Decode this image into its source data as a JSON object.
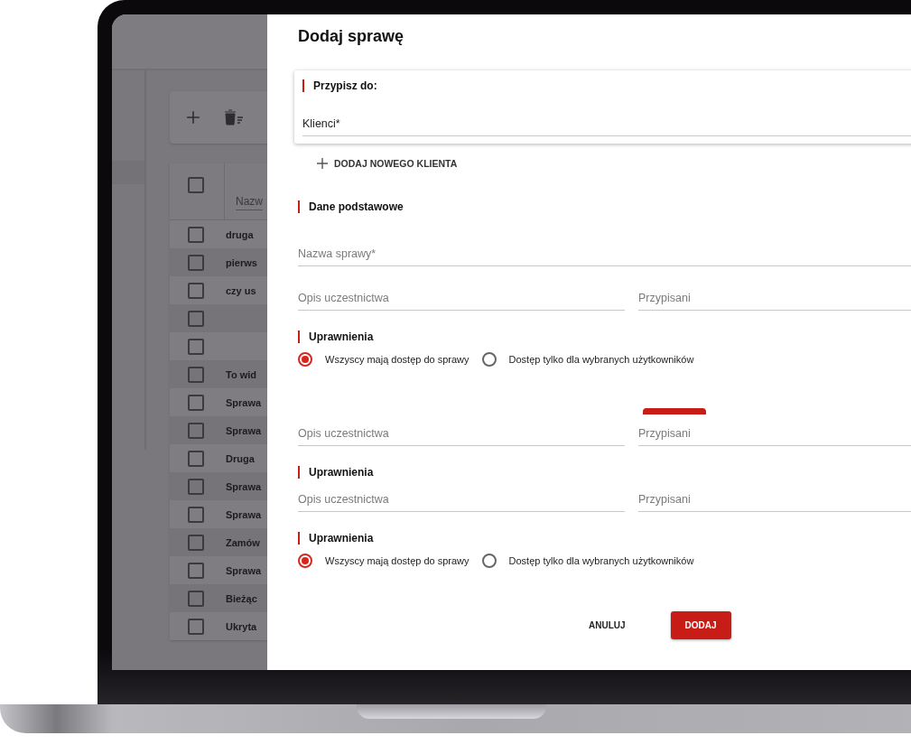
{
  "background_app": {
    "table": {
      "column_1": "Nazw",
      "header_checkbox": {
        "checked": false
      },
      "rows": [
        {
          "name": "druga",
          "checked": false
        },
        {
          "name": "pierws",
          "checked": false
        },
        {
          "name": "czy us",
          "checked": false
        },
        {
          "checked": false
        },
        {
          "checked": false
        },
        {
          "name": "To wid",
          "checked": false
        },
        {
          "name": "Sprawa",
          "checked": false
        },
        {
          "name": "Sprawa",
          "checked": false
        },
        {
          "name": "Druga",
          "checked": false
        },
        {
          "name": "Sprawa",
          "checked": false
        },
        {
          "name": "Sprawa",
          "checked": false
        },
        {
          "name": "Zamów",
          "checked": false
        },
        {
          "name": "Sprawa",
          "checked": false
        },
        {
          "name": "Bieżąc",
          "checked": false
        },
        {
          "name": "Ukryta",
          "checked": false
        }
      ]
    }
  },
  "dialog": {
    "title": "Dodaj sprawę",
    "blocks": [
      {
        "kind": "card",
        "heading": "Przypisz do:",
        "field": {
          "placeholder": "Klienci*"
        }
      },
      {
        "kind": "add",
        "label": "DODAJ NOWEGO KLIENTA"
      },
      {
        "kind": "heading",
        "text": "Dane podstawowe"
      },
      {
        "kind": "field",
        "placeholder": "Nazwa sprawy*"
      },
      {
        "kind": "pair",
        "fields": [
          {
            "placeholder": "Opis uczestnictwa"
          },
          {
            "placeholder": "Przypisani"
          }
        ]
      },
      {
        "kind": "heading",
        "text": "Uprawnienia"
      },
      {
        "kind": "radios",
        "options": [
          {
            "label": "Wszyscy mają dostęp do sprawy",
            "selected": true
          },
          {
            "label": "Dostęp tylko dla wybranych użytkowników",
            "selected": false
          }
        ]
      },
      {
        "kind": "stray"
      },
      {
        "kind": "pair",
        "fields": [
          {
            "placeholder": "Opis uczestnictwa"
          },
          {
            "placeholder": "Przypisani"
          }
        ]
      },
      {
        "kind": "heading",
        "text": "Uprawnienia"
      },
      {
        "kind": "pair",
        "fields": [
          {
            "placeholder": "Opis uczestnictwa"
          },
          {
            "placeholder": "Przypisani"
          }
        ]
      },
      {
        "kind": "heading",
        "text": "Uprawnienia"
      },
      {
        "kind": "radios",
        "options": [
          {
            "label": "Wszyscy mają dostęp do sprawy",
            "selected": true
          },
          {
            "label": "Dostęp tylko dla wybranych użytkowników",
            "selected": false
          }
        ]
      }
    ],
    "buttons": [
      {
        "kind": "text",
        "label": "ANULUJ"
      },
      {
        "kind": "primary",
        "label": "DODAJ"
      }
    ]
  }
}
